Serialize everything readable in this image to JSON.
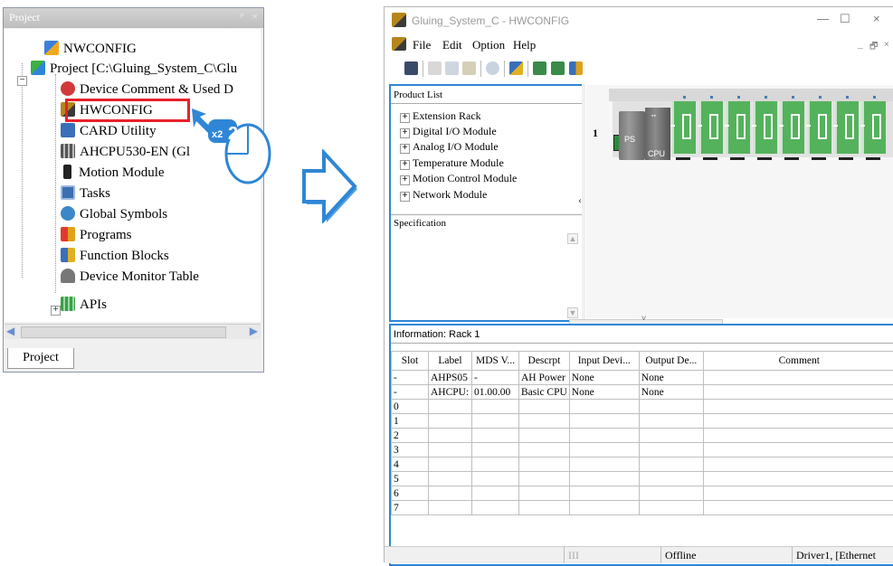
{
  "project_panel": {
    "title": "Project",
    "pin": "ᵖ",
    "close": "×",
    "tree": [
      {
        "label": "NWCONFIG",
        "icon": "nwconfig-icon",
        "color": "#3d7fd8"
      },
      {
        "label": "Project [C:\\Gluing_System_C\\Glu",
        "icon": "project-icon",
        "color": "#3cb043"
      },
      {
        "label": "Device Comment & Used D",
        "icon": "device-comment-icon",
        "color": "#d03a3a"
      },
      {
        "label": "HWCONFIG",
        "icon": "hwconfig-icon",
        "color": "#b5861c"
      },
      {
        "label": "CARD Utility",
        "icon": "card-utility-icon",
        "color": "#3a6fb8"
      },
      {
        "label": "AHCPU530-EN  (Gl",
        "icon": "ahcpu-icon",
        "color": "#777777"
      },
      {
        "label": "Motion Module",
        "icon": "motion-module-icon",
        "color": "#222222"
      },
      {
        "label": "Tasks",
        "icon": "tasks-icon",
        "color": "#3b6fb0"
      },
      {
        "label": "Global Symbols",
        "icon": "global-symbols-icon",
        "color": "#3b87c8"
      },
      {
        "label": "Programs",
        "icon": "programs-icon",
        "color": "#e0a218"
      },
      {
        "label": "Function Blocks",
        "icon": "function-blocks-icon",
        "color": "#d8b020"
      },
      {
        "label": "Device Monitor Table",
        "icon": "device-monitor-icon",
        "color": "#666666"
      },
      {
        "label": "APIs",
        "icon": "apis-icon",
        "color": "#3aa04a"
      }
    ],
    "tab": "Project"
  },
  "click_marker": {
    "count": "x2",
    "step": "2"
  },
  "window": {
    "title": "Gluing_System_C - HWCONFIG",
    "controls": {
      "minimize": "—",
      "maximize": "☐",
      "close": "×"
    },
    "menu": [
      "File",
      "Edit",
      "Option",
      "Help"
    ],
    "menu_right": {
      "min": "_",
      "restore": "🗗",
      "close": "×"
    },
    "product_list": {
      "header": "Product List",
      "items": [
        "Extension Rack",
        "Digital I/O Module",
        "Analog I/O Module",
        "Temperature Module",
        "Motion Control Module",
        "Network Module"
      ],
      "spec_label": "Specification"
    },
    "rack": {
      "number": "1",
      "ps_label": "PS",
      "cpu_label": "CPU",
      "empty_slots": 8
    },
    "info": {
      "header": "Information: Rack 1",
      "columns": [
        "Slot",
        "Label",
        "MDS V...",
        "Descrpt",
        "Input Devi...",
        "Output De...",
        "Comment"
      ],
      "rows": [
        [
          "-",
          "AHPS05",
          "-",
          "AH Power",
          "None",
          "None",
          ""
        ],
        [
          "-",
          "AHCPU:",
          "01.00.00",
          "Basic CPU",
          "None",
          "None",
          ""
        ],
        [
          "0",
          "",
          "",
          "",
          "",
          "",
          ""
        ],
        [
          "1",
          "",
          "",
          "",
          "",
          "",
          ""
        ],
        [
          "2",
          "",
          "",
          "",
          "",
          "",
          ""
        ],
        [
          "3",
          "",
          "",
          "",
          "",
          "",
          ""
        ],
        [
          "4",
          "",
          "",
          "",
          "",
          "",
          ""
        ],
        [
          "5",
          "",
          "",
          "",
          "",
          "",
          ""
        ],
        [
          "6",
          "",
          "",
          "",
          "",
          "",
          ""
        ],
        [
          "7",
          "",
          "",
          "",
          "",
          "",
          ""
        ]
      ]
    },
    "status": {
      "left": "",
      "scroll": "III",
      "mode": "Offline",
      "driver": "Driver1, [Ethernet"
    }
  },
  "colors": {
    "accent": "#2f86d6",
    "highlight_box": "#e8202a",
    "module_green": "#54b25c",
    "click_marker": "#2f86d6"
  }
}
